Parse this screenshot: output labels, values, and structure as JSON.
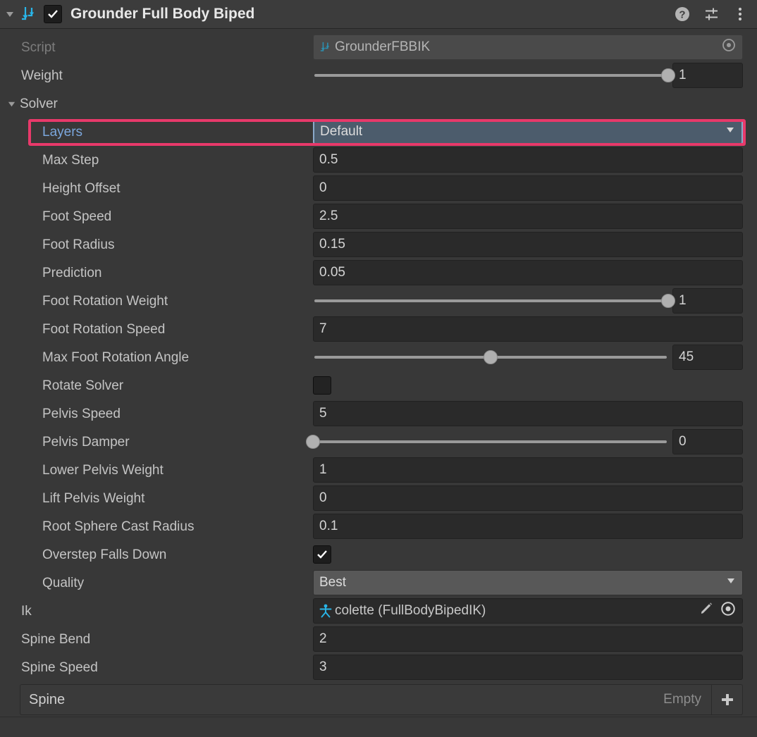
{
  "header": {
    "title": "Grounder Full Body Biped",
    "enabled": true,
    "expanded": true,
    "icon": "grounder-icon",
    "help_icon": "help-icon",
    "preset_icon": "preset-sliders-icon",
    "menu_icon": "more-vertical-icon"
  },
  "colors": {
    "background": "#383838",
    "header_bg": "#3c3c3c",
    "field_bg": "#2a2a2a",
    "popup_bg": "#585858",
    "popup_focused_bg": "#4c5c6c",
    "popup_focused_border": "#8aa9c9",
    "highlight": "#e8396a",
    "accent_cyan": "#29b5e8",
    "label": "#c4c4c4",
    "label_dim": "#7d7d7d",
    "label_focus": "#7ba7dd"
  },
  "rows": {
    "script": {
      "label": "Script",
      "value": "GrounderFBBIK",
      "icon": "script-grounder-icon",
      "picker": "object-picker-icon"
    },
    "weight": {
      "label": "Weight",
      "value": "1",
      "slider_pct": 100
    },
    "solver": {
      "label": "Solver",
      "expanded": true
    },
    "layers": {
      "label": "Layers",
      "value": "Default",
      "highlighted": true,
      "focused": true
    },
    "max_step": {
      "label": "Max Step",
      "value": "0.5"
    },
    "height_offset": {
      "label": "Height Offset",
      "value": "0"
    },
    "foot_speed": {
      "label": "Foot Speed",
      "value": "2.5"
    },
    "foot_radius": {
      "label": "Foot Radius",
      "value": "0.15"
    },
    "prediction": {
      "label": "Prediction",
      "value": "0.05"
    },
    "foot_rotation_weight": {
      "label": "Foot Rotation Weight",
      "value": "1",
      "slider_pct": 100
    },
    "foot_rotation_speed": {
      "label": "Foot Rotation Speed",
      "value": "7"
    },
    "max_foot_rotation_angle": {
      "label": "Max Foot Rotation Angle",
      "value": "45",
      "slider_pct": 50
    },
    "rotate_solver": {
      "label": "Rotate Solver",
      "checked": false
    },
    "pelvis_speed": {
      "label": "Pelvis Speed",
      "value": "5"
    },
    "pelvis_damper": {
      "label": "Pelvis Damper",
      "value": "0",
      "slider_pct": 0
    },
    "lower_pelvis_weight": {
      "label": "Lower Pelvis Weight",
      "value": "1"
    },
    "lift_pelvis_weight": {
      "label": "Lift Pelvis Weight",
      "value": "0"
    },
    "root_sphere_cast_radius": {
      "label": "Root Sphere Cast Radius",
      "value": "0.1"
    },
    "overstep_falls_down": {
      "label": "Overstep Falls Down",
      "checked": true
    },
    "quality": {
      "label": "Quality",
      "value": "Best"
    },
    "ik": {
      "label": "Ik",
      "value": "colette (FullBodyBipedIK)",
      "icon": "fbbik-character-icon",
      "edit_icon": "pencil-edit-icon",
      "picker": "object-picker-icon"
    },
    "spine_bend": {
      "label": "Spine Bend",
      "value": "2"
    },
    "spine_speed": {
      "label": "Spine Speed",
      "value": "3"
    }
  },
  "spine_list": {
    "title": "Spine",
    "empty_label": "Empty",
    "add_icon": "plus-icon"
  }
}
